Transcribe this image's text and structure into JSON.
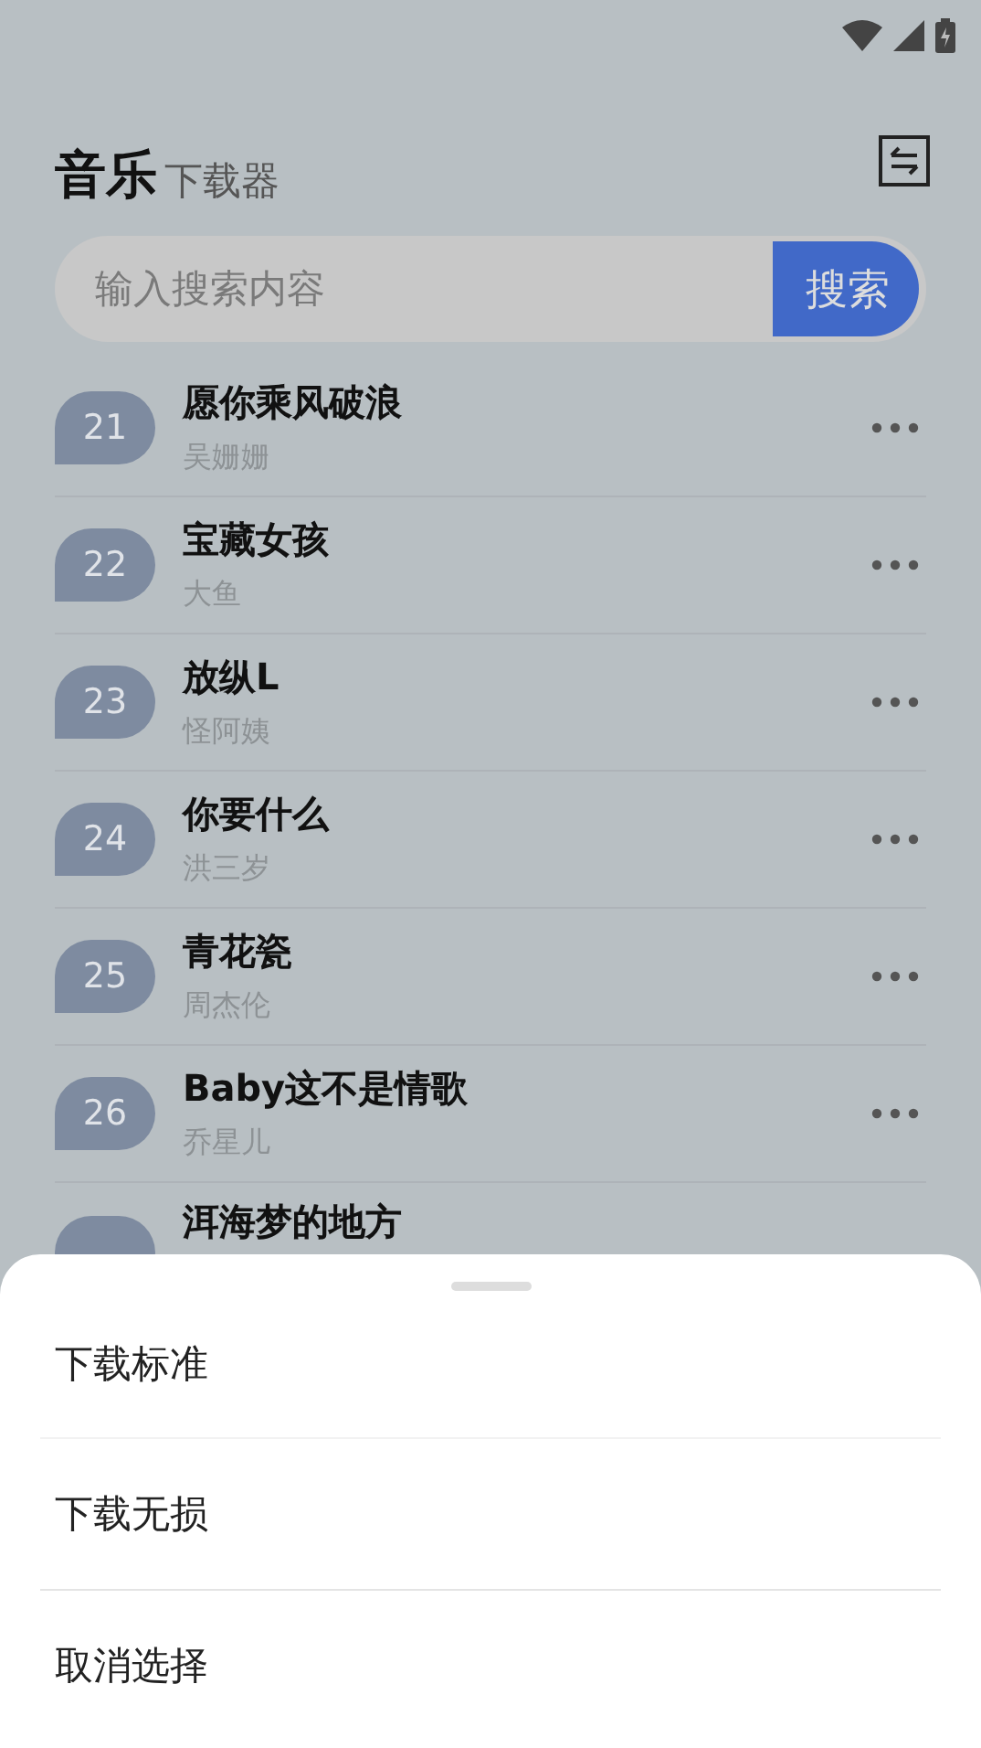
{
  "header": {
    "title": "音乐",
    "subtitle": "下载器"
  },
  "search": {
    "placeholder": "输入搜索内容",
    "button": "搜索"
  },
  "songs": [
    {
      "number": "21",
      "title": "愿你乘风破浪",
      "artist": "吴姗姗"
    },
    {
      "number": "22",
      "title": "宝藏女孩",
      "artist": "大鱼"
    },
    {
      "number": "23",
      "title": "放纵L",
      "artist": "怪阿姨"
    },
    {
      "number": "24",
      "title": "你要什么",
      "artist": "洪三岁"
    },
    {
      "number": "25",
      "title": "青花瓷",
      "artist": "周杰伦"
    },
    {
      "number": "26",
      "title": "Baby这不是情歌",
      "artist": "乔星儿"
    },
    {
      "title": "洱海梦的地方"
    }
  ],
  "sheet": {
    "options": [
      "下载标准",
      "下载无损",
      "取消选择"
    ]
  }
}
